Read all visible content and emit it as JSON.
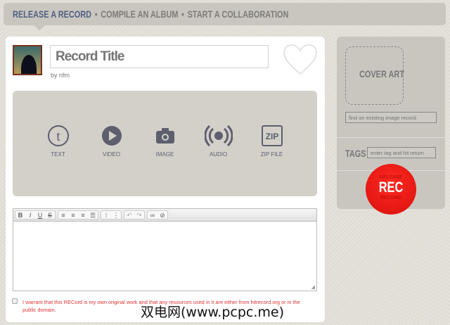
{
  "nav": {
    "items": [
      "RELEASE A RECORD",
      "COMPILE AN ALBUM",
      "START A COLLABORATION"
    ],
    "separator": "•"
  },
  "record": {
    "title_placeholder": "Record Title",
    "byline": "by nfm"
  },
  "media": [
    {
      "label": "TEXT",
      "icon": "text-icon"
    },
    {
      "label": "VIDEO",
      "icon": "play-icon"
    },
    {
      "label": "IMAGE",
      "icon": "camera-icon"
    },
    {
      "label": "AUDIO",
      "icon": "audio-icon"
    },
    {
      "label": "ZIP FILE",
      "icon": "zip-icon",
      "glyph": "ZIP"
    }
  ],
  "toolbar": {
    "bold": "B",
    "italic": "I",
    "underline": "U",
    "strike": "S"
  },
  "warrant": "I warrant that this RECord is my own original work and that any resources used in it are either from hitrecord.org or in the public domain.",
  "side": {
    "cover_art": "COVER ART",
    "image_search_placeholder": "find an existing image record",
    "tags_label": "TAGS",
    "tags_placeholder": "enter tag and hit return"
  },
  "rec_button": {
    "top": "RELEASE",
    "main": "REC",
    "bottom": "RECORD",
    "color": "#e8140f"
  },
  "watermark": "双电网(www.pcpc.me)"
}
